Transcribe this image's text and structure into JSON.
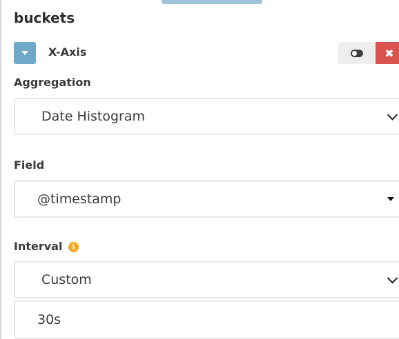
{
  "section": {
    "title": "buckets"
  },
  "aggregation_row": {
    "name": "X-Axis",
    "toggle_icon": "caret-down-icon",
    "disable_icon": "toggle-switch-icon",
    "remove_icon": "close-icon",
    "remove_glyph": "✖"
  },
  "aggregation": {
    "label": "Aggregation",
    "value": "Date Histogram"
  },
  "field": {
    "label": "Field",
    "value": "@timestamp"
  },
  "interval": {
    "label": "Interval",
    "info_glyph": "i",
    "value": "Custom",
    "custom_value": "30s"
  },
  "colors": {
    "accent": "#6ea9c9",
    "danger": "#d9534f",
    "info": "#f5a623"
  }
}
